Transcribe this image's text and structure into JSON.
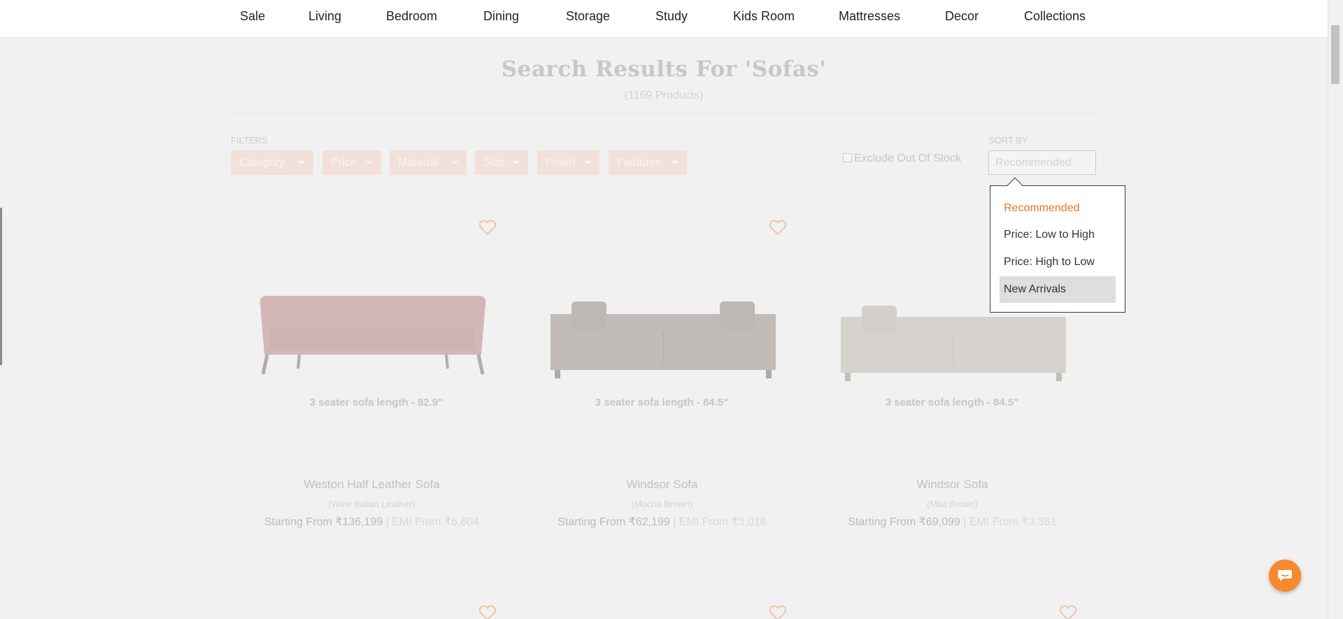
{
  "nav": {
    "items": [
      "Sale",
      "Living",
      "Bedroom",
      "Dining",
      "Storage",
      "Study",
      "Kids Room",
      "Mattresses",
      "Decor",
      "Collections"
    ]
  },
  "search": {
    "title": "Search Results For 'Sofas'",
    "count": "(1169 Products)"
  },
  "filters": {
    "label": "FILTERS",
    "chips": [
      "Category",
      "Price",
      "Material",
      "Size",
      "Finish",
      "Features"
    ],
    "exclude_out_of_stock": "Exclude Out Of Stock",
    "exclude_checked": false
  },
  "sort": {
    "label": "SORT BY",
    "selected": "Recommended",
    "options": [
      "Recommended",
      "Price: Low to High",
      "Price: High to Low",
      "New Arrivals"
    ],
    "highlighted": "New Arrivals"
  },
  "products": [
    {
      "caption": "3 seater sofa length - 82.9\"",
      "name": "Weston Half Leather Sofa",
      "variant": "(Wine Italian Leather)",
      "price": "Starting From ₹136,199",
      "emi": " | EMI From ₹6,604",
      "color": "#9a4a4a"
    },
    {
      "caption": "3 seater sofa length - 84.5\"",
      "name": "Windsor Sofa",
      "variant": "(Mocha Brown)",
      "price": "Starting From ₹62,199",
      "emi": " | EMI From ₹3,016",
      "color": "#6b5a50"
    },
    {
      "caption": "3 seater sofa length - 84.5\"",
      "name": "Windsor Sofa",
      "variant": "(Mist Brown)",
      "price": "Starting From ₹69,099",
      "emi": " | EMI From ₹3,351",
      "color": "#a49a8c"
    }
  ],
  "colors": {
    "accent": "#e8742a",
    "chip": "#f3c3ae",
    "chat": "#f7892f"
  },
  "icons": {
    "heart": "heart-icon",
    "chat": "chat-icon"
  }
}
